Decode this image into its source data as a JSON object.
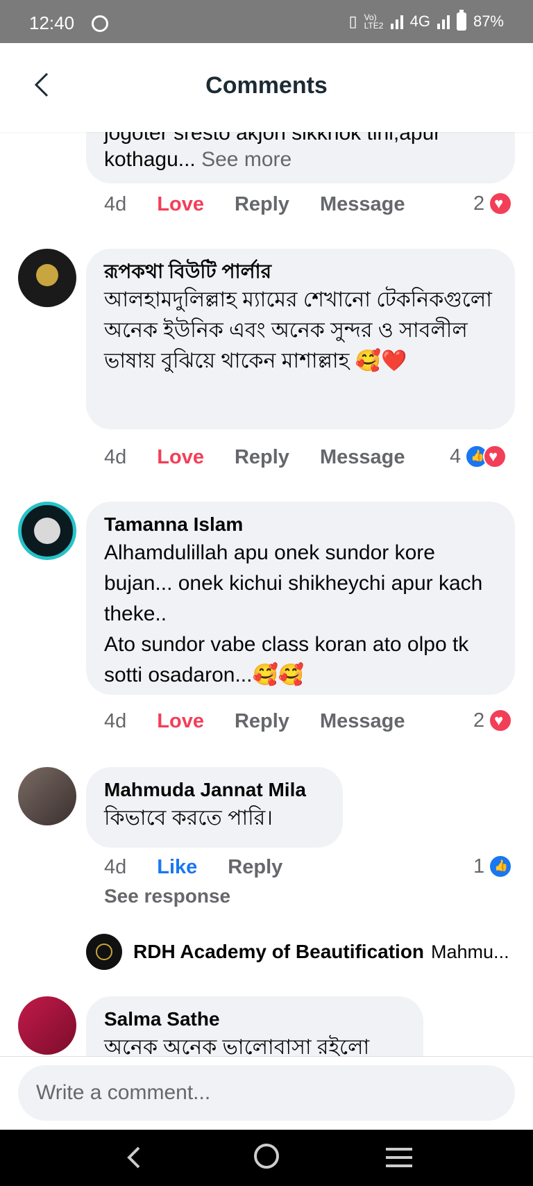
{
  "status_bar": {
    "time": "12:40",
    "network": "Vo) LTE2",
    "net_type": "4G",
    "battery": "87%"
  },
  "header": {
    "title": "Comments"
  },
  "comments": [
    {
      "text_partial_top": "jogoter sresto akjon sikkhok tini,apur",
      "text": "kothagu...",
      "see_more": "See more",
      "time": "4d",
      "reaction_label": "Love",
      "reply": "Reply",
      "message": "Message",
      "reaction_count": "2"
    },
    {
      "author": "রূপকথা বিউটি পার্লার",
      "text": "আলহামদুলিল্লাহ ম্যামের শেখানো টেকনিকগুলো অনেক ইউনিক এবং অনেক সুন্দর ও সাবলীল ভাষায় বুঝিয়ে থাকেন মাশাল্লাহ 🥰❤️",
      "time": "4d",
      "reaction_label": "Love",
      "reply": "Reply",
      "message": "Message",
      "reaction_count": "4"
    },
    {
      "author": "Tamanna Islam",
      "text": "Alhamdulillah apu onek sundor kore bujan... onek kichui shikheychi apur kach theke..",
      "text2": "Ato sundor vabe class koran ato olpo tk sotti osadaron...🥰🥰",
      "time": "4d",
      "reaction_label": "Love",
      "reply": "Reply",
      "message": "Message",
      "reaction_count": "2"
    },
    {
      "author": "Mahmuda Jannat Mila",
      "text": "কিভাবে করতে পারি।",
      "time": "4d",
      "reaction_label": "Like",
      "reply": "Reply",
      "reaction_count": "1",
      "see_response": "See response",
      "reply_preview": {
        "author": "RDH Academy of Beautification",
        "snippet": "Mahmu..."
      }
    },
    {
      "author": "Salma Sathe",
      "text": "অনেক অনেক ভালোবাসা রইলো"
    }
  ],
  "composer": {
    "placeholder": "Write a comment..."
  }
}
